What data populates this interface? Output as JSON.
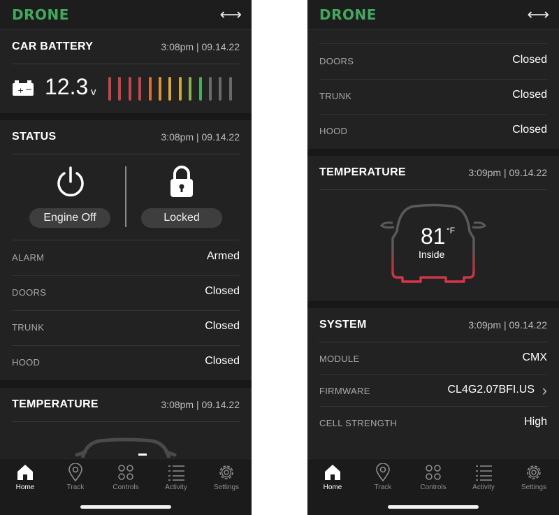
{
  "app": {
    "brand": "DRONE",
    "expand_icon": "horizontal-arrows-icon",
    "accent": "#43a85f"
  },
  "screen_left": {
    "battery": {
      "title": "CAR BATTERY",
      "time": "3:08pm | 09.14.22",
      "voltage": "12.3",
      "unit": "v",
      "bar_colors": [
        "#c8434a",
        "#c8434a",
        "#c8434a",
        "#c8434a",
        "#d0713e",
        "#d9923a",
        "#dfa43a",
        "#cfa63e",
        "#8bb04c",
        "#4fa95b",
        "#6a6a6a",
        "#6a6a6a",
        "#6a6a6a"
      ]
    },
    "status": {
      "title": "STATUS",
      "time": "3:08pm | 09.14.22",
      "engine_label": "Engine Off",
      "lock_label": "Locked",
      "rows": [
        {
          "label": "ALARM",
          "value": "Armed"
        },
        {
          "label": "DOORS",
          "value": "Closed"
        },
        {
          "label": "TRUNK",
          "value": "Closed"
        },
        {
          "label": "HOOD",
          "value": "Closed"
        }
      ]
    },
    "temperature": {
      "title": "TEMPERATURE",
      "time": "3:08pm | 09.14.22"
    }
  },
  "screen_right": {
    "status_rows": [
      {
        "label": "DOORS",
        "value": "Closed"
      },
      {
        "label": "TRUNK",
        "value": "Closed"
      },
      {
        "label": "HOOD",
        "value": "Closed"
      }
    ],
    "temperature": {
      "title": "TEMPERATURE",
      "time": "3:09pm | 09.14.22",
      "value": "81",
      "unit": "°F",
      "location": "Inside"
    },
    "system": {
      "title": "SYSTEM",
      "time": "3:09pm | 09.14.22",
      "rows": [
        {
          "label": "MODULE",
          "value": "CMX"
        },
        {
          "label": "FIRMWARE",
          "value": "CL4G2.07BFI.US"
        },
        {
          "label": "CELL STRENGTH",
          "value": "High"
        }
      ]
    }
  },
  "tabs": [
    {
      "label": "Home",
      "icon": "home-icon",
      "active": true
    },
    {
      "label": "Track",
      "icon": "map-pin-icon",
      "active": false
    },
    {
      "label": "Controls",
      "icon": "controls-icon",
      "active": false
    },
    {
      "label": "Activity",
      "icon": "list-icon",
      "active": false
    },
    {
      "label": "Settings",
      "icon": "gear-icon",
      "active": false
    }
  ]
}
